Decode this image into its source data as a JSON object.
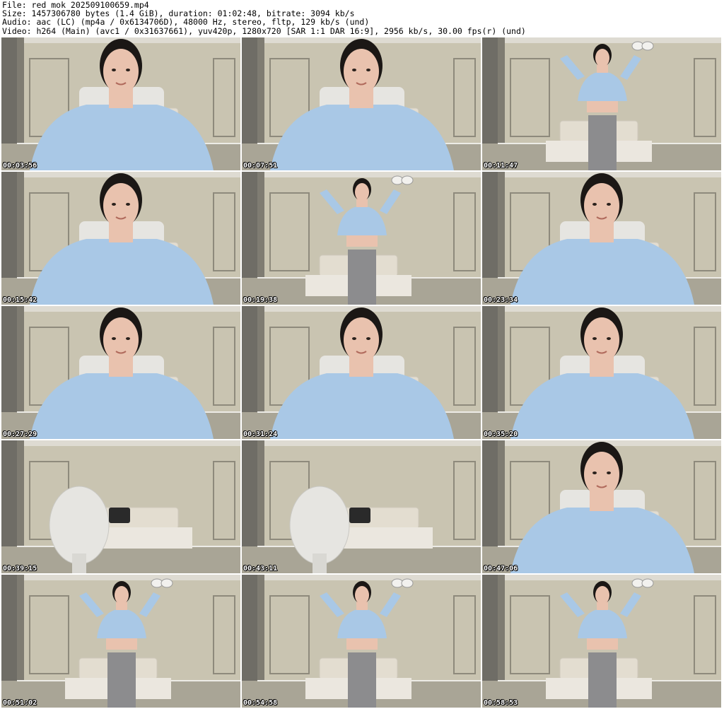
{
  "header": {
    "file_line": "File: red_mok_202509100659.mp4",
    "size_line": "Size: 1457306780 bytes (1.4 GiB), duration: 01:02:48, bitrate: 3094 kb/s",
    "audio_line": "Audio: aac (LC) (mp4a / 0x6134706D), 48000 Hz, stereo, fltp, 129 kb/s (und)",
    "video_line": "Video: h264 (Main) (avc1 / 0x31637661), yuv420p, 1280x720 [SAR 1:1 DAR 16:9], 2956 kb/s, 30.00 fps(r) (und)"
  },
  "thumbnails": [
    {
      "timestamp": "00:03:56",
      "scene": "closeup"
    },
    {
      "timestamp": "00:07:51",
      "scene": "closeup"
    },
    {
      "timestamp": "00:11:47",
      "scene": "standing"
    },
    {
      "timestamp": "00:15:42",
      "scene": "closeup"
    },
    {
      "timestamp": "00:19:38",
      "scene": "standing"
    },
    {
      "timestamp": "00:23:34",
      "scene": "closeup"
    },
    {
      "timestamp": "00:27:29",
      "scene": "closeup"
    },
    {
      "timestamp": "00:31:24",
      "scene": "closeup"
    },
    {
      "timestamp": "00:35:20",
      "scene": "closeup"
    },
    {
      "timestamp": "00:39:15",
      "scene": "empty-room"
    },
    {
      "timestamp": "00:43:11",
      "scene": "empty-room"
    },
    {
      "timestamp": "00:47:06",
      "scene": "closeup"
    },
    {
      "timestamp": "00:51:02",
      "scene": "standing"
    },
    {
      "timestamp": "00:54:58",
      "scene": "standing"
    },
    {
      "timestamp": "00:58:53",
      "scene": "standing"
    }
  ],
  "colors": {
    "wall": "#c9c4b1",
    "wall_shadow": "#8e8a7c",
    "curtain": "#6f6d66",
    "floor": "#a9a596",
    "ceiling": "#dedbd2",
    "sweater": "#a9c8e6",
    "pants": "#8c8c8e",
    "hair": "#1b1715",
    "skin": "#e9c2ae",
    "bed": "#ebe7df",
    "chair": "#e6e5e1"
  }
}
